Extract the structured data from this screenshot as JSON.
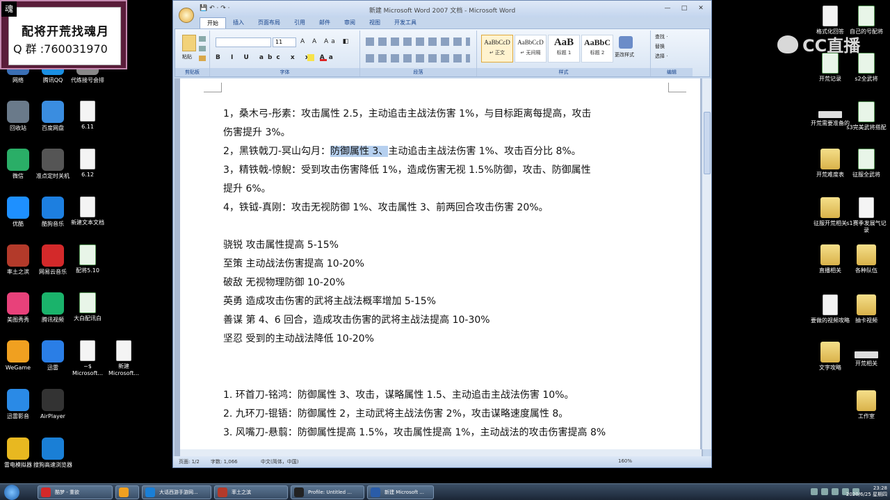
{
  "overlay": {
    "corner_glyph": "魂",
    "line1": "配将开荒找魂月",
    "line2": "Q 群 :760031970"
  },
  "watermark": {
    "brand": "CC直播"
  },
  "desktop_left_icons": [
    {
      "label": "网络",
      "kind": "app",
      "color": "#3a6fb5"
    },
    {
      "label": "腾讯QQ",
      "kind": "app",
      "color": "#1a8fe3"
    },
    {
      "label": "代练接号会排",
      "kind": "app",
      "color": "#888888"
    },
    {
      "label": "回收站",
      "kind": "app",
      "color": "#6a7a8a"
    },
    {
      "label": "百度网盘",
      "kind": "app",
      "color": "#3a8de0"
    },
    {
      "label": "6.11",
      "kind": "doc"
    },
    {
      "label": "微信",
      "kind": "app",
      "color": "#2aae67"
    },
    {
      "label": "准点定时关机",
      "kind": "app",
      "color": "#555555"
    },
    {
      "label": "6.12",
      "kind": "doc"
    },
    {
      "label": "优酷",
      "kind": "app",
      "color": "#1e90ff"
    },
    {
      "label": "酷狗音乐",
      "kind": "app",
      "color": "#1d7fe0"
    },
    {
      "label": "新建文本文档",
      "kind": "doc"
    },
    {
      "label": "率土之滨",
      "kind": "app",
      "color": "#b33a2a"
    },
    {
      "label": "网易云音乐",
      "kind": "app",
      "color": "#d3292a"
    },
    {
      "label": "配将5.10",
      "kind": "xls"
    },
    {
      "label": "美图秀秀",
      "kind": "app",
      "color": "#e8417a"
    },
    {
      "label": "腾讯视频",
      "kind": "app",
      "color": "#1ab36b"
    },
    {
      "label": "大白配讯白",
      "kind": "xls"
    },
    {
      "label": "WeGame",
      "kind": "app",
      "color": "#f0a020"
    },
    {
      "label": "迅雷",
      "kind": "app",
      "color": "#2a7ee6"
    },
    {
      "label": "~$\nMicrosoft...",
      "kind": "doc"
    },
    {
      "label": "新建\nMicrosoft...",
      "kind": "doc"
    },
    {
      "label": "迅雷影音",
      "kind": "app",
      "color": "#2a8ae6"
    },
    {
      "label": "AirPlayer",
      "kind": "app",
      "color": "#333333"
    },
    {
      "label": "雷电模拟器",
      "kind": "app",
      "color": "#e8b820"
    },
    {
      "label": "搜狗高速浏览器",
      "kind": "app",
      "color": "#1a7fd6"
    }
  ],
  "desktop_right_icons": [
    {
      "label": "格式化回答",
      "kind": "doc"
    },
    {
      "label": "自己的号配将",
      "kind": "xls"
    },
    {
      "label": "开荒记录",
      "kind": "xls"
    },
    {
      "label": "s2全武将",
      "kind": "xls"
    },
    {
      "label": "开荒需要准备的",
      "kind": "thin"
    },
    {
      "label": "s3完美武将搭配",
      "kind": "xls"
    },
    {
      "label": "开荒难度表",
      "kind": "folder"
    },
    {
      "label": "征服全武将",
      "kind": "xls"
    },
    {
      "label": "征服开荒相关",
      "kind": "folder"
    },
    {
      "label": "s1赛季发展气记录",
      "kind": "doc"
    },
    {
      "label": "直播相关",
      "kind": "folder"
    },
    {
      "label": "各种队伍",
      "kind": "folder"
    },
    {
      "label": "要做的视频攻略",
      "kind": "doc"
    },
    {
      "label": "抽卡视频",
      "kind": "folder"
    },
    {
      "label": "文字攻略",
      "kind": "folder"
    },
    {
      "label": "开荒相关",
      "kind": "thin"
    },
    {
      "label": "工作室",
      "kind": "folder"
    }
  ],
  "word": {
    "title": "新建 Microsoft Word 2007 文档 - Microsoft Word",
    "qat": "💾 ↶ · ↷ ·",
    "window_controls": [
      "—",
      "□",
      "✕"
    ],
    "tabs": [
      "开始",
      "插入",
      "页面布局",
      "引用",
      "邮件",
      "审阅",
      "视图",
      "开发工具"
    ],
    "ribbon": {
      "groups": [
        "剪贴板",
        "字体",
        "段落",
        "样式",
        "编辑"
      ],
      "paste_label": "粘贴",
      "font_name": "",
      "font_size": "11",
      "styles": [
        {
          "sample": "AaBbCcD",
          "name": "↵ 正文"
        },
        {
          "sample": "AaBbCcD",
          "name": "↵ 无间隔"
        },
        {
          "sample": "AaB",
          "name": "标题 1"
        },
        {
          "sample": "AaBbC",
          "name": "标题 2"
        }
      ],
      "change_styles": "更改样式",
      "editing": [
        "查找 ·",
        "替换",
        "选择 ·"
      ]
    },
    "document": {
      "lines": [
        {
          "text": "1，桑木弓-彤素：攻击属性 2.5，主动追击主战法伤害 1%，与目标距离每提高，攻击",
          "sel": ""
        },
        {
          "text": "伤害提升 3%。",
          "sel": ""
        },
        {
          "pre": "2，黑铁戟刀-冥山勾月：",
          "sel": "防御属性 3、",
          "post": "主动追击主战法伤害 1%、攻击百分比 8%。"
        },
        {
          "text": "3，精铁戟-惊鲵：受到攻击伤害降低 1%，造成伤害无视 1.5%防御，攻击、防御属性",
          "sel": ""
        },
        {
          "text": "提升 6%。",
          "sel": ""
        },
        {
          "text": "4，铁钺-真刚：攻击无视防御 1%、攻击属性 3、前两回合攻击伤害 20%。",
          "sel": ""
        },
        {
          "text": "",
          "sel": ""
        },
        {
          "text": "骁锐 攻击属性提高 5-15%",
          "sel": ""
        },
        {
          "text": "至策 主动战法伤害提高 10-20%",
          "sel": ""
        },
        {
          "text": "破敌 无视物理防御 10-20%",
          "sel": ""
        },
        {
          "text": "英勇 造成攻击伤害的武将主战法概率增加 5-15%",
          "sel": ""
        },
        {
          "text": "善谋 第 4、6 回合，造成攻击伤害的武将主战法提高 10-30%",
          "sel": ""
        },
        {
          "text": "坚忍 受到的主动战法降低 10-20%",
          "sel": ""
        },
        {
          "text": "",
          "sel": ""
        },
        {
          "text": "",
          "sel": ""
        },
        {
          "text": "1. 环首刀-铭鸿：防御属性 3、攻击，谋略属性 1.5、主动追击主战法伤害 10%。",
          "sel": ""
        },
        {
          "text": "2. 九环刀-锟铻：防御属性 2，主动武将主战法伤害 2%，攻击谋略速度属性 8。",
          "sel": ""
        },
        {
          "text": "3. 风嘴刀-悬翦：防御属性提高 1.5%，攻击属性提高 1%，主动战法的攻击伤害提高 8%",
          "sel": ""
        }
      ]
    },
    "status": {
      "page": "页面: 1/2",
      "words": "字数: 1,066",
      "lang": "中文(简体，中国)",
      "zoom": "160%"
    }
  },
  "taskbar": {
    "tasks": [
      {
        "label": "酷梦 - 重欲",
        "color": "#d3292a"
      },
      {
        "label": "",
        "color": "#f0a020"
      },
      {
        "label": "大话西游手游网...",
        "color": "#1a7fd6"
      },
      {
        "label": "率土之滨",
        "color": "#b33a2a"
      },
      {
        "label": "Profile: Untitled ...",
        "color": "#222222"
      },
      {
        "label": "新建 Microsoft ...",
        "color": "#2a5ca8"
      }
    ],
    "clock_time": "23:28",
    "clock_date": "2020/6/25 星期四"
  }
}
